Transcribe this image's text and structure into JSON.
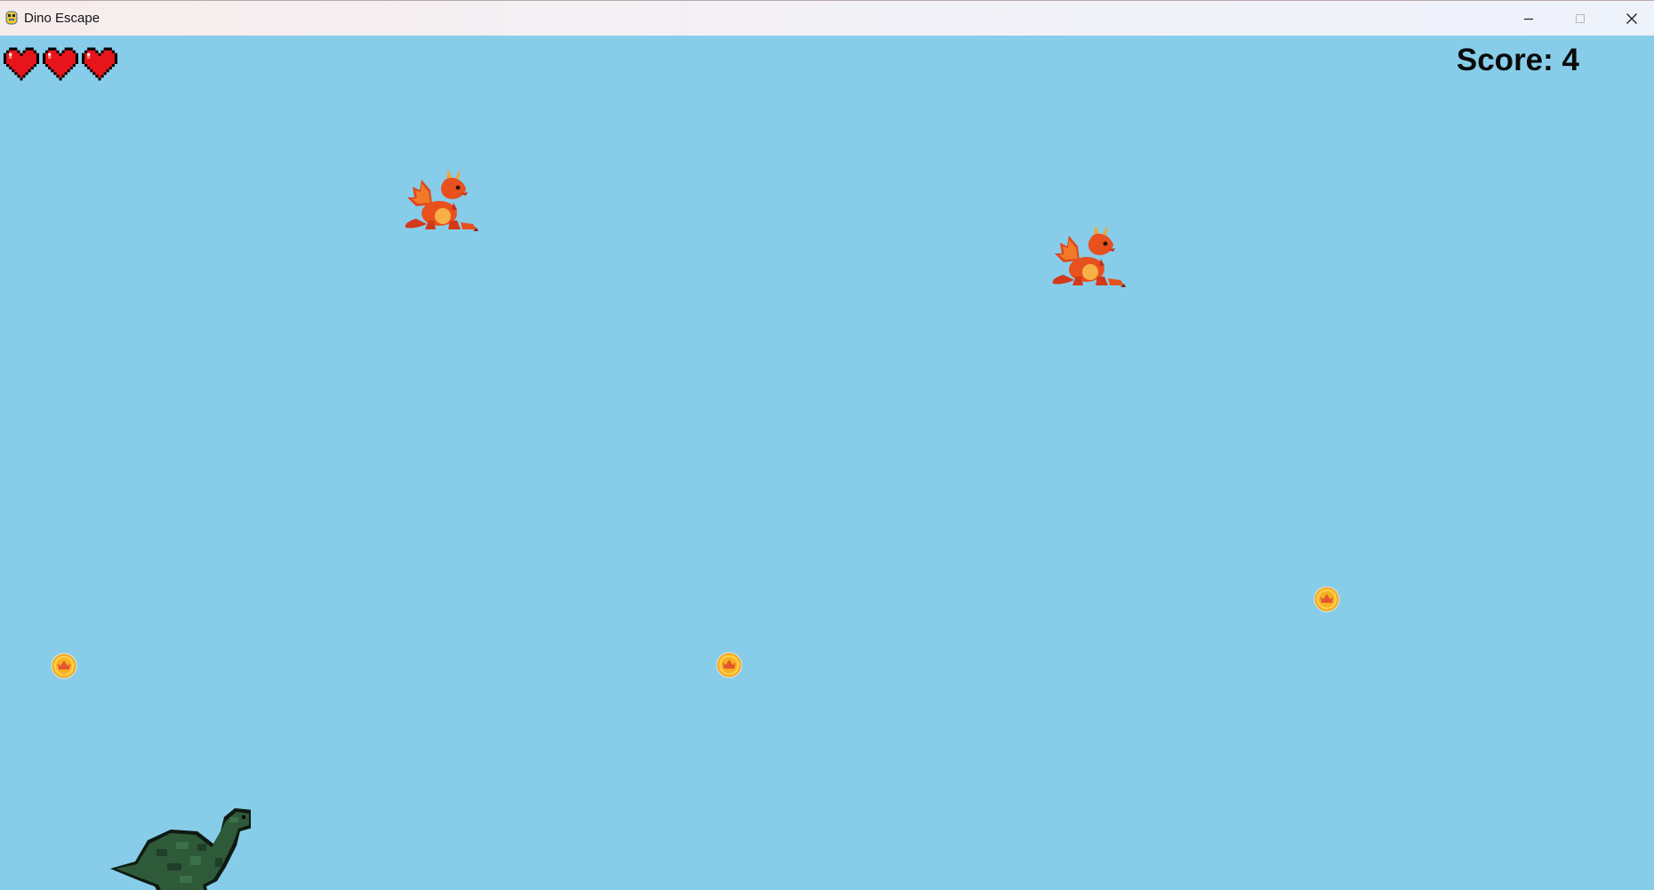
{
  "window": {
    "title": "Dino Escape",
    "app_icon": "pygame-snake-icon",
    "controls": [
      "minimize-icon",
      "maximize-icon",
      "close-icon"
    ]
  },
  "hud": {
    "lives": 3,
    "heart_icon": "heart-icon",
    "heart_color": "#E8141B",
    "score_text": "Score: 4"
  },
  "scene": {
    "background_color": "#87CDE9",
    "enemies": [
      {
        "type": "dragon",
        "icon": "dragon-icon"
      },
      {
        "type": "dragon",
        "icon": "dragon-icon"
      }
    ],
    "coins": [
      {
        "icon": "coin-icon"
      },
      {
        "icon": "coin-icon"
      },
      {
        "icon": "coin-icon"
      }
    ],
    "player": {
      "type": "dinosaur",
      "icon": "dinosaur-icon",
      "color": "#2E5A3A"
    }
  }
}
